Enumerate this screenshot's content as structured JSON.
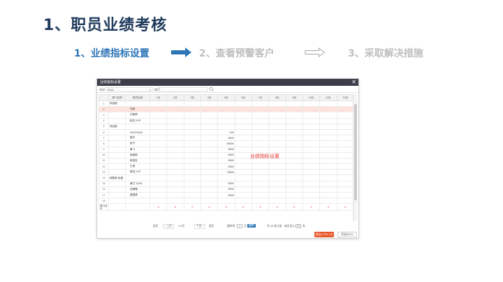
{
  "slide": {
    "title": "1、职员业绩考核",
    "steps": [
      {
        "label": "1、业绩指标设置"
      },
      {
        "label": "2、查看预警客户"
      },
      {
        "label": "3、采取解决措施"
      }
    ],
    "colors": {
      "title": "#1f3a5c",
      "active": "#2e75b6",
      "inactive": "#bfbfbf",
      "highlight": "#e53935",
      "save": "#e8572a"
    }
  },
  "window": {
    "title": "业绩指标设置",
    "close_glyph": "✕",
    "filter": {
      "year_label": "年份",
      "year_value": "2021",
      "dept_label": "部门"
    },
    "overlay_label": "业绩指标设置",
    "table": {
      "headers": [
        "",
        "部门名称",
        "职员名称",
        "1月",
        "2月",
        "3月",
        "4月",
        "5月",
        "6月",
        "7月",
        "8月",
        "9月",
        "10月",
        "11月",
        "12月"
      ],
      "rows": [
        {
          "n": "1",
          "dept": "系统部",
          "emp": "",
          "may": ""
        },
        {
          "n": "2",
          "dept": "",
          "emp": "刘泽",
          "may": ""
        },
        {
          "n": "3",
          "dept": "",
          "emp": "刘泽明",
          "may": ""
        },
        {
          "n": "4",
          "dept": "",
          "emp": "职员-ZYP",
          "may": ""
        },
        {
          "n": "5",
          "dept": "测试部",
          "emp": "",
          "may": ""
        },
        {
          "n": "6",
          "dept": "",
          "emp": "ZHOYXUN",
          "may": "100"
        },
        {
          "n": "7",
          "dept": "",
          "emp": "童宇",
          "may": "5000"
        },
        {
          "n": "8",
          "dept": "",
          "emp": "赵兴",
          "may": "50000"
        },
        {
          "n": "9",
          "dept": "",
          "emp": "黄飞",
          "may": "5000"
        },
        {
          "n": "10",
          "dept": "",
          "emp": "邱维明",
          "may": "5000"
        },
        {
          "n": "11",
          "dept": "",
          "emp": "陈俊发",
          "may": "5000"
        },
        {
          "n": "12",
          "dept": "",
          "emp": "王涛",
          "may": "5000"
        },
        {
          "n": "13",
          "dept": "",
          "emp": "职员-ZYP",
          "may": "75000"
        },
        {
          "n": "14",
          "dept": "销售部-运营",
          "emp": "",
          "may": ""
        },
        {
          "n": "15",
          "dept": "",
          "emp": "黄文飞LEA",
          "may": "5000"
        },
        {
          "n": "16",
          "dept": "",
          "emp": "范珊珊",
          "may": "5000"
        },
        {
          "n": "17",
          "dept": "",
          "emp": "曾国清",
          "may": "5000"
        },
        {
          "n": "18",
          "dept": "",
          "emp": "",
          "may": ""
        }
      ],
      "total_label": "部门合计",
      "total_values": [
        "0",
        "0",
        "0",
        "0",
        "0",
        "0",
        "0",
        "0",
        "0",
        "0",
        "0",
        "0"
      ]
    },
    "pager": {
      "first": "首页",
      "prev": "上页",
      "page_info": "1/1页",
      "next": "下页",
      "last": "尾页",
      "jump_label": "跳转到",
      "page_input": "1",
      "page_suffix": "页",
      "go": "跳转",
      "total": "共 35 条记录",
      "per_page_label": "每页显示",
      "per_page_value": "20",
      "per_page_suffix": "条"
    },
    "save_label": "保存(CTRL+S)",
    "close_label": "关闭(ESC)"
  }
}
